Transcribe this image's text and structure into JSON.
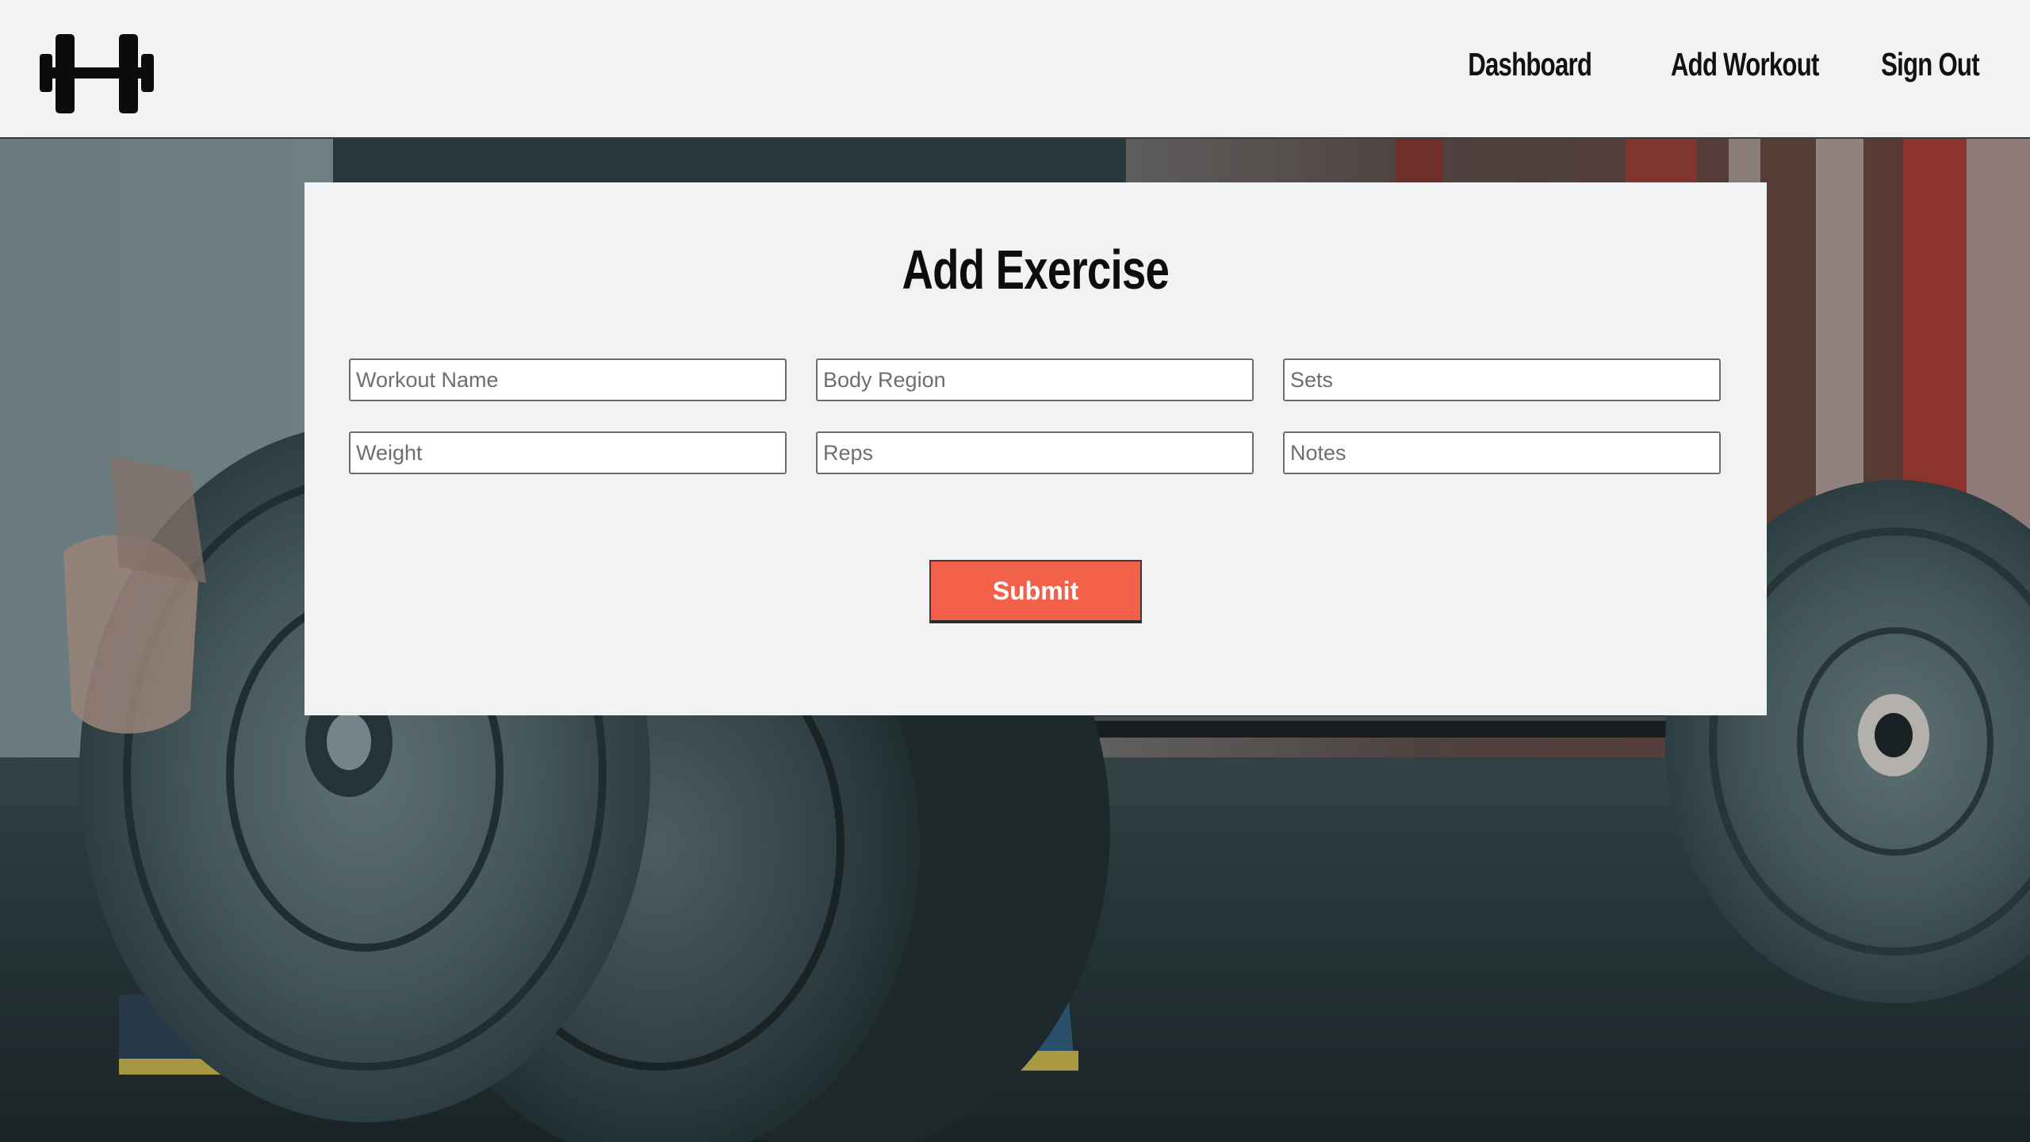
{
  "header": {
    "logo_icon": "dumbbell-logo-icon",
    "nav": [
      {
        "label": "Dashboard"
      },
      {
        "label": "Add Workout"
      },
      {
        "label": "Sign Out"
      }
    ]
  },
  "background": {
    "description_icon": "barbell-photo-background"
  },
  "form": {
    "title": "Add Exercise",
    "fields": {
      "workout_name": {
        "placeholder": "Workout Name",
        "value": ""
      },
      "body_region": {
        "placeholder": "Body Region",
        "value": ""
      },
      "sets": {
        "placeholder": "Sets",
        "value": ""
      },
      "weight": {
        "placeholder": "Weight",
        "value": ""
      },
      "reps": {
        "placeholder": "Reps",
        "value": ""
      },
      "notes": {
        "placeholder": "Notes",
        "value": ""
      }
    },
    "submit_label": "Submit"
  },
  "colors": {
    "accent": "#f3614a",
    "surface": "#f1f2f3",
    "text": "#0d0d0d"
  }
}
